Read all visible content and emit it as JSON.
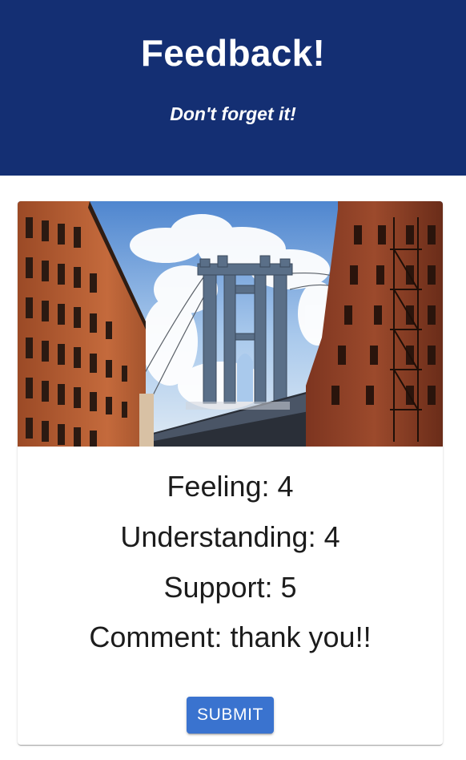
{
  "header": {
    "title": "Feedback!",
    "subtitle": "Don't forget it!"
  },
  "review": {
    "feeling_label": "Feeling: 4",
    "understanding_label": "Understanding: 4",
    "support_label": "Support: 5",
    "comment_label": "Comment: thank you!!",
    "submit_label": "SUBMIT"
  },
  "colors": {
    "header_background": "#142f73",
    "button_background": "#3a73cf",
    "text": "#1c1c1c"
  }
}
